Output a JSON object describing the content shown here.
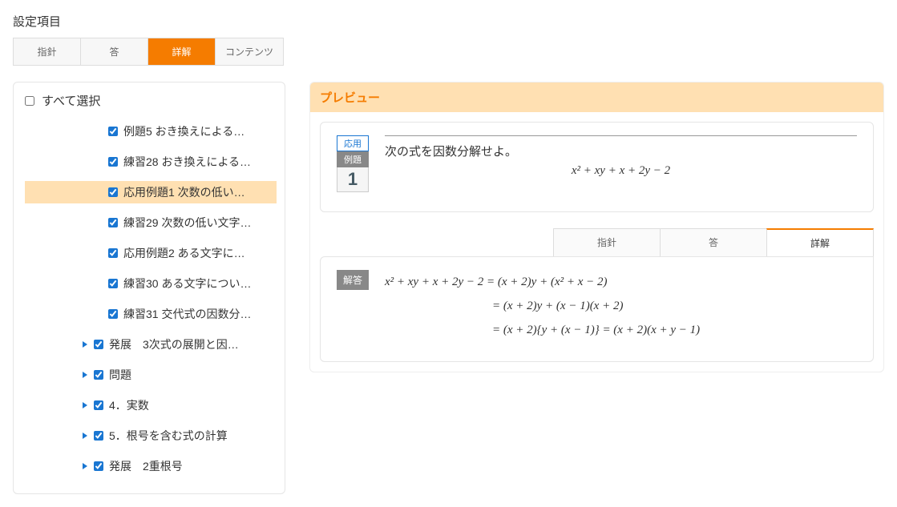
{
  "section_title": "設定項目",
  "top_tabs": [
    "指針",
    "答",
    "詳解",
    "コンテンツ"
  ],
  "top_active_index": 2,
  "select_all_label": "すべて選択",
  "tree": [
    {
      "type": "leaf",
      "checked": true,
      "selected": false,
      "label": "例題5 おき換えによる…"
    },
    {
      "type": "leaf",
      "checked": true,
      "selected": false,
      "label": "練習28 おき換えによる…"
    },
    {
      "type": "leaf",
      "checked": true,
      "selected": true,
      "label": "応用例題1 次数の低い…"
    },
    {
      "type": "leaf",
      "checked": true,
      "selected": false,
      "label": "練習29 次数の低い文字…"
    },
    {
      "type": "leaf",
      "checked": true,
      "selected": false,
      "label": "応用例題2 ある文字に…"
    },
    {
      "type": "leaf",
      "checked": true,
      "selected": false,
      "label": "練習30 ある文字につい…"
    },
    {
      "type": "leaf",
      "checked": true,
      "selected": false,
      "label": "練習31 交代式の因数分…"
    },
    {
      "type": "branch",
      "checked": true,
      "label": "発展　3次式の展開と因…"
    },
    {
      "type": "branch",
      "checked": true,
      "label": "問題"
    },
    {
      "type": "branch",
      "checked": true,
      "label": "4．実数"
    },
    {
      "type": "branch",
      "checked": true,
      "label": "5．根号を含む式の計算"
    },
    {
      "type": "branch",
      "checked": true,
      "label": "発展　2重根号"
    }
  ],
  "preview_title": "プレビュー",
  "problem": {
    "badge_top": "応用",
    "badge_mid": "例題",
    "badge_num": "1",
    "statement": "次の式を因数分解せよ。",
    "expr": "x² + xy + x + 2y − 2"
  },
  "sub_tabs": [
    "指針",
    "答",
    "詳解"
  ],
  "sub_active_index": 2,
  "answer": {
    "badge": "解答",
    "lines": [
      "x² + xy + x + 2y − 2 = (x + 2)y + (x² + x − 2)",
      "= (x + 2)y + (x − 1)(x + 2)",
      "= (x + 2){y + (x − 1)} = (x + 2)(x + y − 1)"
    ]
  }
}
